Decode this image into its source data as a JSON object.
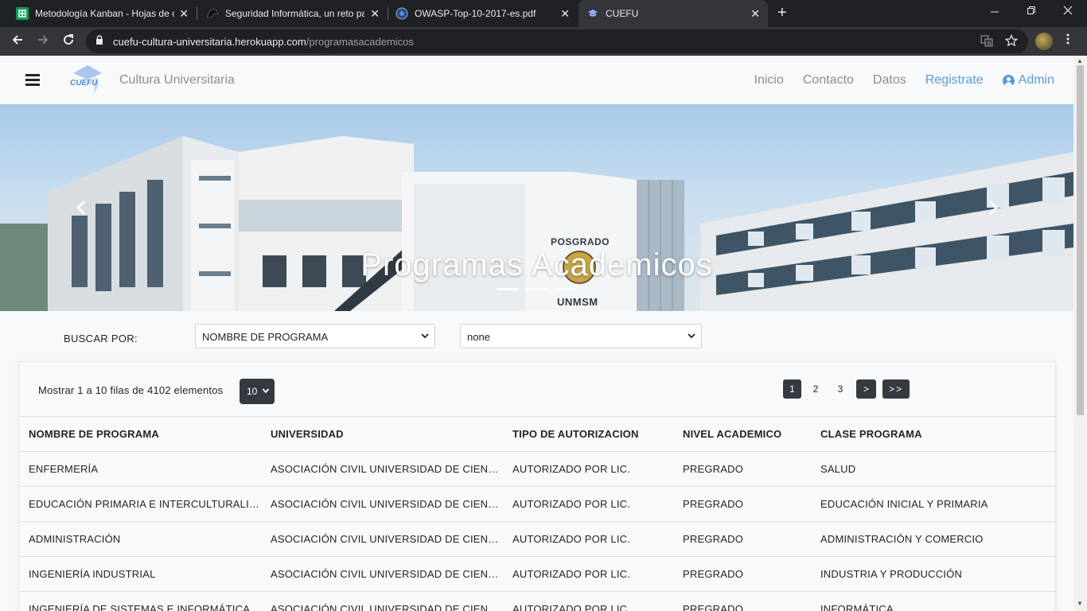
{
  "browser": {
    "tabs": [
      {
        "title": "Metodología Kanban - Hojas de cálculo",
        "icon": "sheets-icon"
      },
      {
        "title": "Seguridad Informática, un reto para",
        "icon": "panther-icon"
      },
      {
        "title": "OWASP-Top-10-2017-es.pdf",
        "icon": "globe-icon"
      },
      {
        "title": "CUEFU",
        "icon": "graduation-cap-icon"
      }
    ],
    "url_host": "cuefu-cultura-universitaria.herokuapp.com",
    "url_path": "/programasacademicos"
  },
  "navbar": {
    "logo_text": "CUEFU",
    "brand": "Cultura Universitaria",
    "links": [
      {
        "label": "Inicio"
      },
      {
        "label": "Contacto"
      },
      {
        "label": "Datos"
      },
      {
        "label": "Registrate"
      }
    ],
    "admin_label": "Admin"
  },
  "hero": {
    "title": "Programas Academicos",
    "building_sign_1": "POSGRADO",
    "building_sign_2": "UNMSM"
  },
  "search": {
    "label": "BUSCAR POR:",
    "field_selected": "NOMBRE DE PROGRAMA",
    "value_selected": "none"
  },
  "table_card": {
    "showing_text": "Mostrar 1 a 10 filas de 4102 elementos",
    "page_size": "10",
    "pages": [
      "1",
      "2",
      "3"
    ],
    "next_label": ">",
    "last_label": ">>",
    "columns": [
      "NOMBRE DE PROGRAMA",
      "UNIVERSIDAD",
      "TIPO DE AUTORIZACION",
      "NIVEL ACADEMICO",
      "CLASE PROGRAMA"
    ],
    "rows": [
      [
        "ENFERMERÍA",
        "ASOCIACIÓN CIVIL UNIVERSIDAD DE CIENCIAS...",
        "AUTORIZADO POR LIC.",
        "PREGRADO",
        "SALUD"
      ],
      [
        "EDUCACIÓN PRIMARIA E INTERCULTURALIDAD",
        "ASOCIACIÓN CIVIL UNIVERSIDAD DE CIENCIAS...",
        "AUTORIZADO POR LIC.",
        "PREGRADO",
        "EDUCACIÓN INICIAL Y PRIMARIA"
      ],
      [
        "ADMINISTRACIÓN",
        "ASOCIACIÓN CIVIL UNIVERSIDAD DE CIENCIAS...",
        "AUTORIZADO POR LIC.",
        "PREGRADO",
        "ADMINISTRACIÓN Y COMERCIO"
      ],
      [
        "INGENIERÍA INDUSTRIAL",
        "ASOCIACIÓN CIVIL UNIVERSIDAD DE CIENCIAS...",
        "AUTORIZADO POR LIC.",
        "PREGRADO",
        "INDUSTRIA Y PRODUCCIÓN"
      ],
      [
        "INGENIERÍA DE SISTEMAS E INFORMÁTICA",
        "ASOCIACIÓN CIVIL UNIVERSIDAD DE CIENCIAS...",
        "AUTORIZADO POR LIC.",
        "PREGRADO",
        "INFORMÁTICA"
      ]
    ]
  },
  "colors": {
    "accent": "#5b9bd5",
    "dark_button": "#343a40",
    "chrome_bg": "#202124"
  }
}
